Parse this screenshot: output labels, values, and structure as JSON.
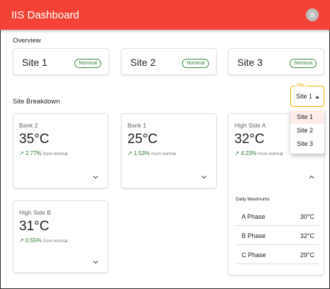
{
  "app": {
    "title": "IIS Dashboard",
    "avatar_letter": "a",
    "accent": "#f44336"
  },
  "overview": {
    "label": "Overview",
    "sites": [
      {
        "name": "Site 1",
        "status": "Nominal"
      },
      {
        "name": "Site 2",
        "status": "Nominal"
      },
      {
        "name": "Site 3",
        "status": "Nominal"
      }
    ]
  },
  "breakdown": {
    "label": "Site Breakdown",
    "select": {
      "legend": "Site",
      "value": "Site 1",
      "options": [
        "Site 1",
        "Site 2",
        "Site 3"
      ]
    },
    "cards": [
      {
        "name": "Bank 2",
        "temp": "35°C",
        "trend": "2.77%",
        "trend_note": "from normal",
        "expanded": false
      },
      {
        "name": "Bank 1",
        "temp": "25°C",
        "trend": "1.53%",
        "trend_note": "from normal",
        "expanded": false
      },
      {
        "name": "High Side A",
        "temp": "32°C",
        "trend": "4.23%",
        "trend_note": "from normal",
        "expanded": true,
        "daily_max": {
          "title": "Daily Maximums",
          "rows": [
            {
              "phase": "A Phase",
              "value": "30°C"
            },
            {
              "phase": "B Phase",
              "value": "32°C"
            },
            {
              "phase": "C Phase",
              "value": "29°C"
            }
          ]
        }
      },
      {
        "name": "High Side B",
        "temp": "31°C",
        "trend": "0.55%",
        "trend_note": "from normal",
        "expanded": false
      }
    ]
  }
}
